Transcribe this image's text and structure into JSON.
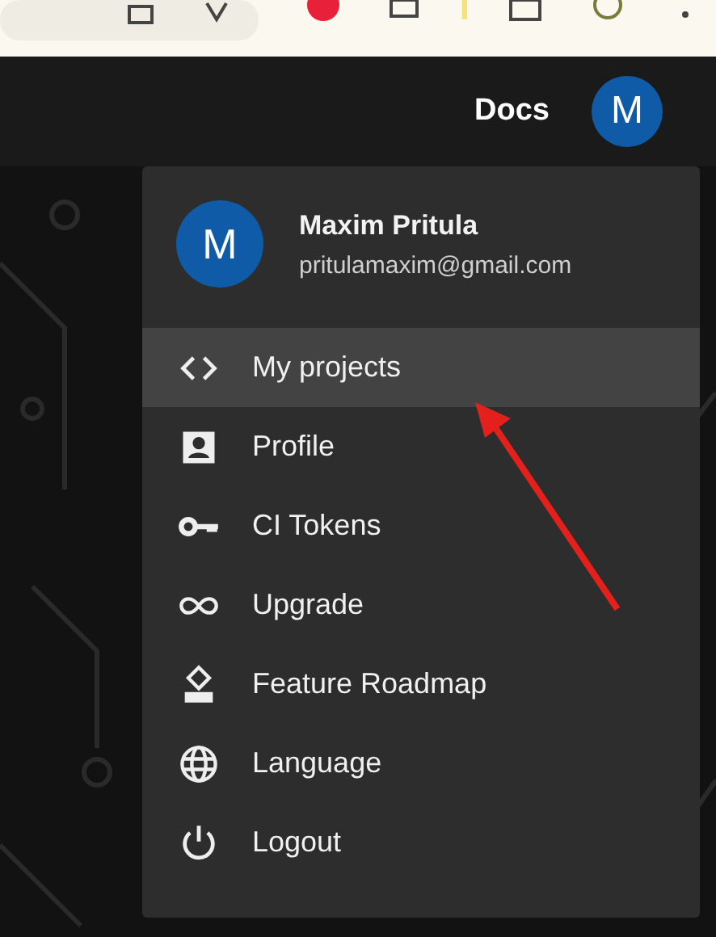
{
  "header": {
    "links": [
      "Docs"
    ],
    "avatar_letter": "M"
  },
  "menu": {
    "user": {
      "avatar_letter": "M",
      "name": "Maxim Pritula",
      "email": "pritulamaxim@gmail.com"
    },
    "items": [
      {
        "kind": "code",
        "label": "My projects",
        "selected": true
      },
      {
        "kind": "profile",
        "label": "Profile",
        "selected": false
      },
      {
        "kind": "key",
        "label": "CI Tokens",
        "selected": false
      },
      {
        "kind": "infinity",
        "label": "Upgrade",
        "selected": false
      },
      {
        "kind": "roadmap",
        "label": "Feature Roadmap",
        "selected": false
      },
      {
        "kind": "globe",
        "label": "Language",
        "selected": false
      },
      {
        "kind": "power",
        "label": "Logout",
        "selected": false
      }
    ]
  },
  "annotation_arrow": true
}
